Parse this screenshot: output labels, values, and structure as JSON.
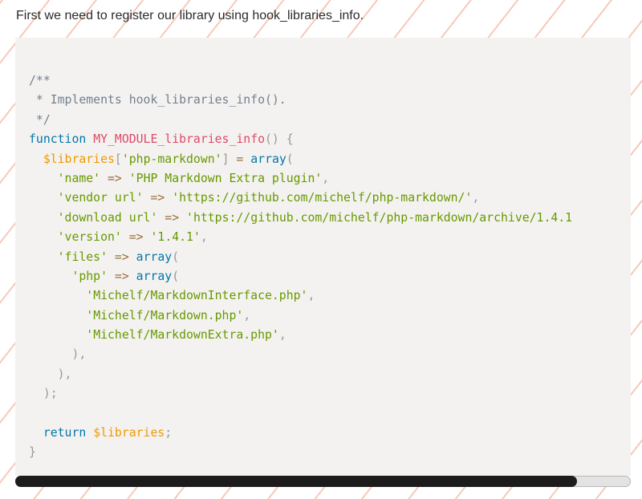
{
  "intro_text": "First we need to register our library using hook_libraries_info.",
  "code": {
    "comment_open": "/**",
    "comment_body": " * Implements hook_libraries_info().",
    "comment_close": " */",
    "kw_function": "function",
    "fn_name": "MY_MODULE_libraries_info",
    "var_libraries": "$libraries",
    "key_php_markdown": "'php-markdown'",
    "kw_array": "array",
    "key_name": "'name'",
    "val_name": "'PHP Markdown Extra plugin'",
    "key_vendor_url": "'vendor url'",
    "val_vendor_url": "'https://github.com/michelf/php-markdown/'",
    "key_download_url": "'download url'",
    "val_download_url": "'https://github.com/michelf/php-markdown/archive/1.4.1",
    "key_version": "'version'",
    "val_version": "'1.4.1'",
    "key_files": "'files'",
    "key_php": "'php'",
    "file_1": "'Michelf/MarkdownInterface.php'",
    "file_2": "'Michelf/Markdown.php'",
    "file_3": "'Michelf/MarkdownExtra.php'",
    "kw_return": "return"
  },
  "scrollbar": {
    "position": 0.91
  },
  "colors": {
    "comment": "#708090",
    "keyword": "#0077aa",
    "function": "#dd4a68",
    "variable": "#ee9900",
    "string": "#669900",
    "punctuation": "#999999",
    "operator": "#9a6e3a",
    "code_background": "#f4f2f0",
    "stripe": "#f7c9b8"
  }
}
